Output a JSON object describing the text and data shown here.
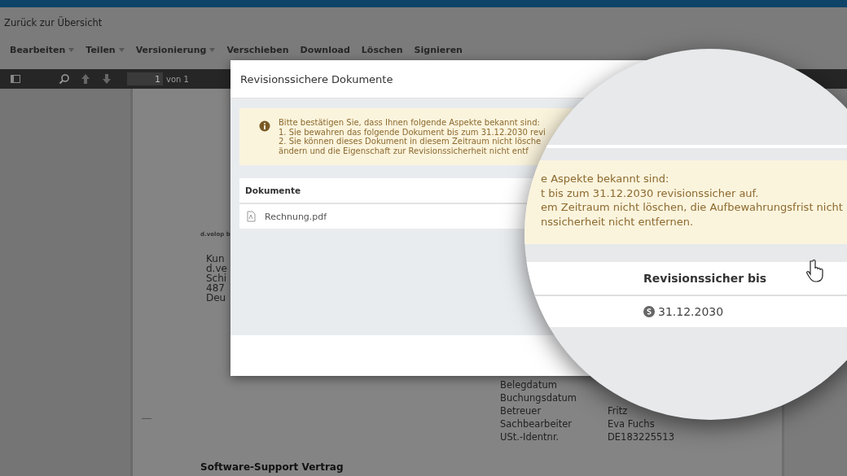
{
  "back_link": "Zurück zur Übersicht",
  "menu": [
    {
      "label": "Bearbeiten",
      "dropdown": true
    },
    {
      "label": "Teilen",
      "dropdown": true
    },
    {
      "label": "Versionierung",
      "dropdown": true
    },
    {
      "label": "Verschieben",
      "dropdown": false
    },
    {
      "label": "Download",
      "dropdown": false
    },
    {
      "label": "Löschen",
      "dropdown": false
    },
    {
      "label": "Signieren",
      "dropdown": false
    }
  ],
  "pdf_toolbar": {
    "page": "1",
    "page_count": "von 1"
  },
  "pdf_page": {
    "sender": "d.velop b",
    "address": [
      "Kun",
      "d.ve",
      "Schi",
      "487",
      "Deu"
    ],
    "details": [
      {
        "label": "Belegdatum"
      },
      {
        "label": "Buchungsdatum"
      },
      {
        "label": "Betreuer",
        "value": "Fritz"
      },
      {
        "label": "Sachbearbeiter",
        "value": "Eva Fuchs"
      },
      {
        "label": "USt.-Identnr.",
        "value": "DE183225513"
      }
    ],
    "title": "Software-Support Vertrag"
  },
  "dialog": {
    "title": "Revisionssichere Dokumente",
    "alert": [
      "Bitte bestätigen Sie, dass Ihnen folgende Aspekte bekannt sind:",
      "1. Sie bewahren das folgende Dokument bis zum 31.12.2030 revi",
      "2. Sie können dieses Dokument in diesem Zeitraum nicht lösche",
      "ändern und die Eigenschaft zur Revisionssicherheit nicht entf"
    ],
    "table": {
      "columns": [
        "Dokumente"
      ],
      "rows": [
        [
          "Rechnung.pdf"
        ]
      ]
    }
  },
  "magnifier": {
    "alert": [
      "e Aspekte bekannt sind:",
      "t bis zum 31.12.2030 revisionssicher auf.",
      "em Zeitraum nicht löschen, die Aufbewahrungsfrist nicht",
      "nssicherheit nicht entfernen."
    ],
    "column": "Revisionssicher bis",
    "cell": "31.12.2030"
  }
}
